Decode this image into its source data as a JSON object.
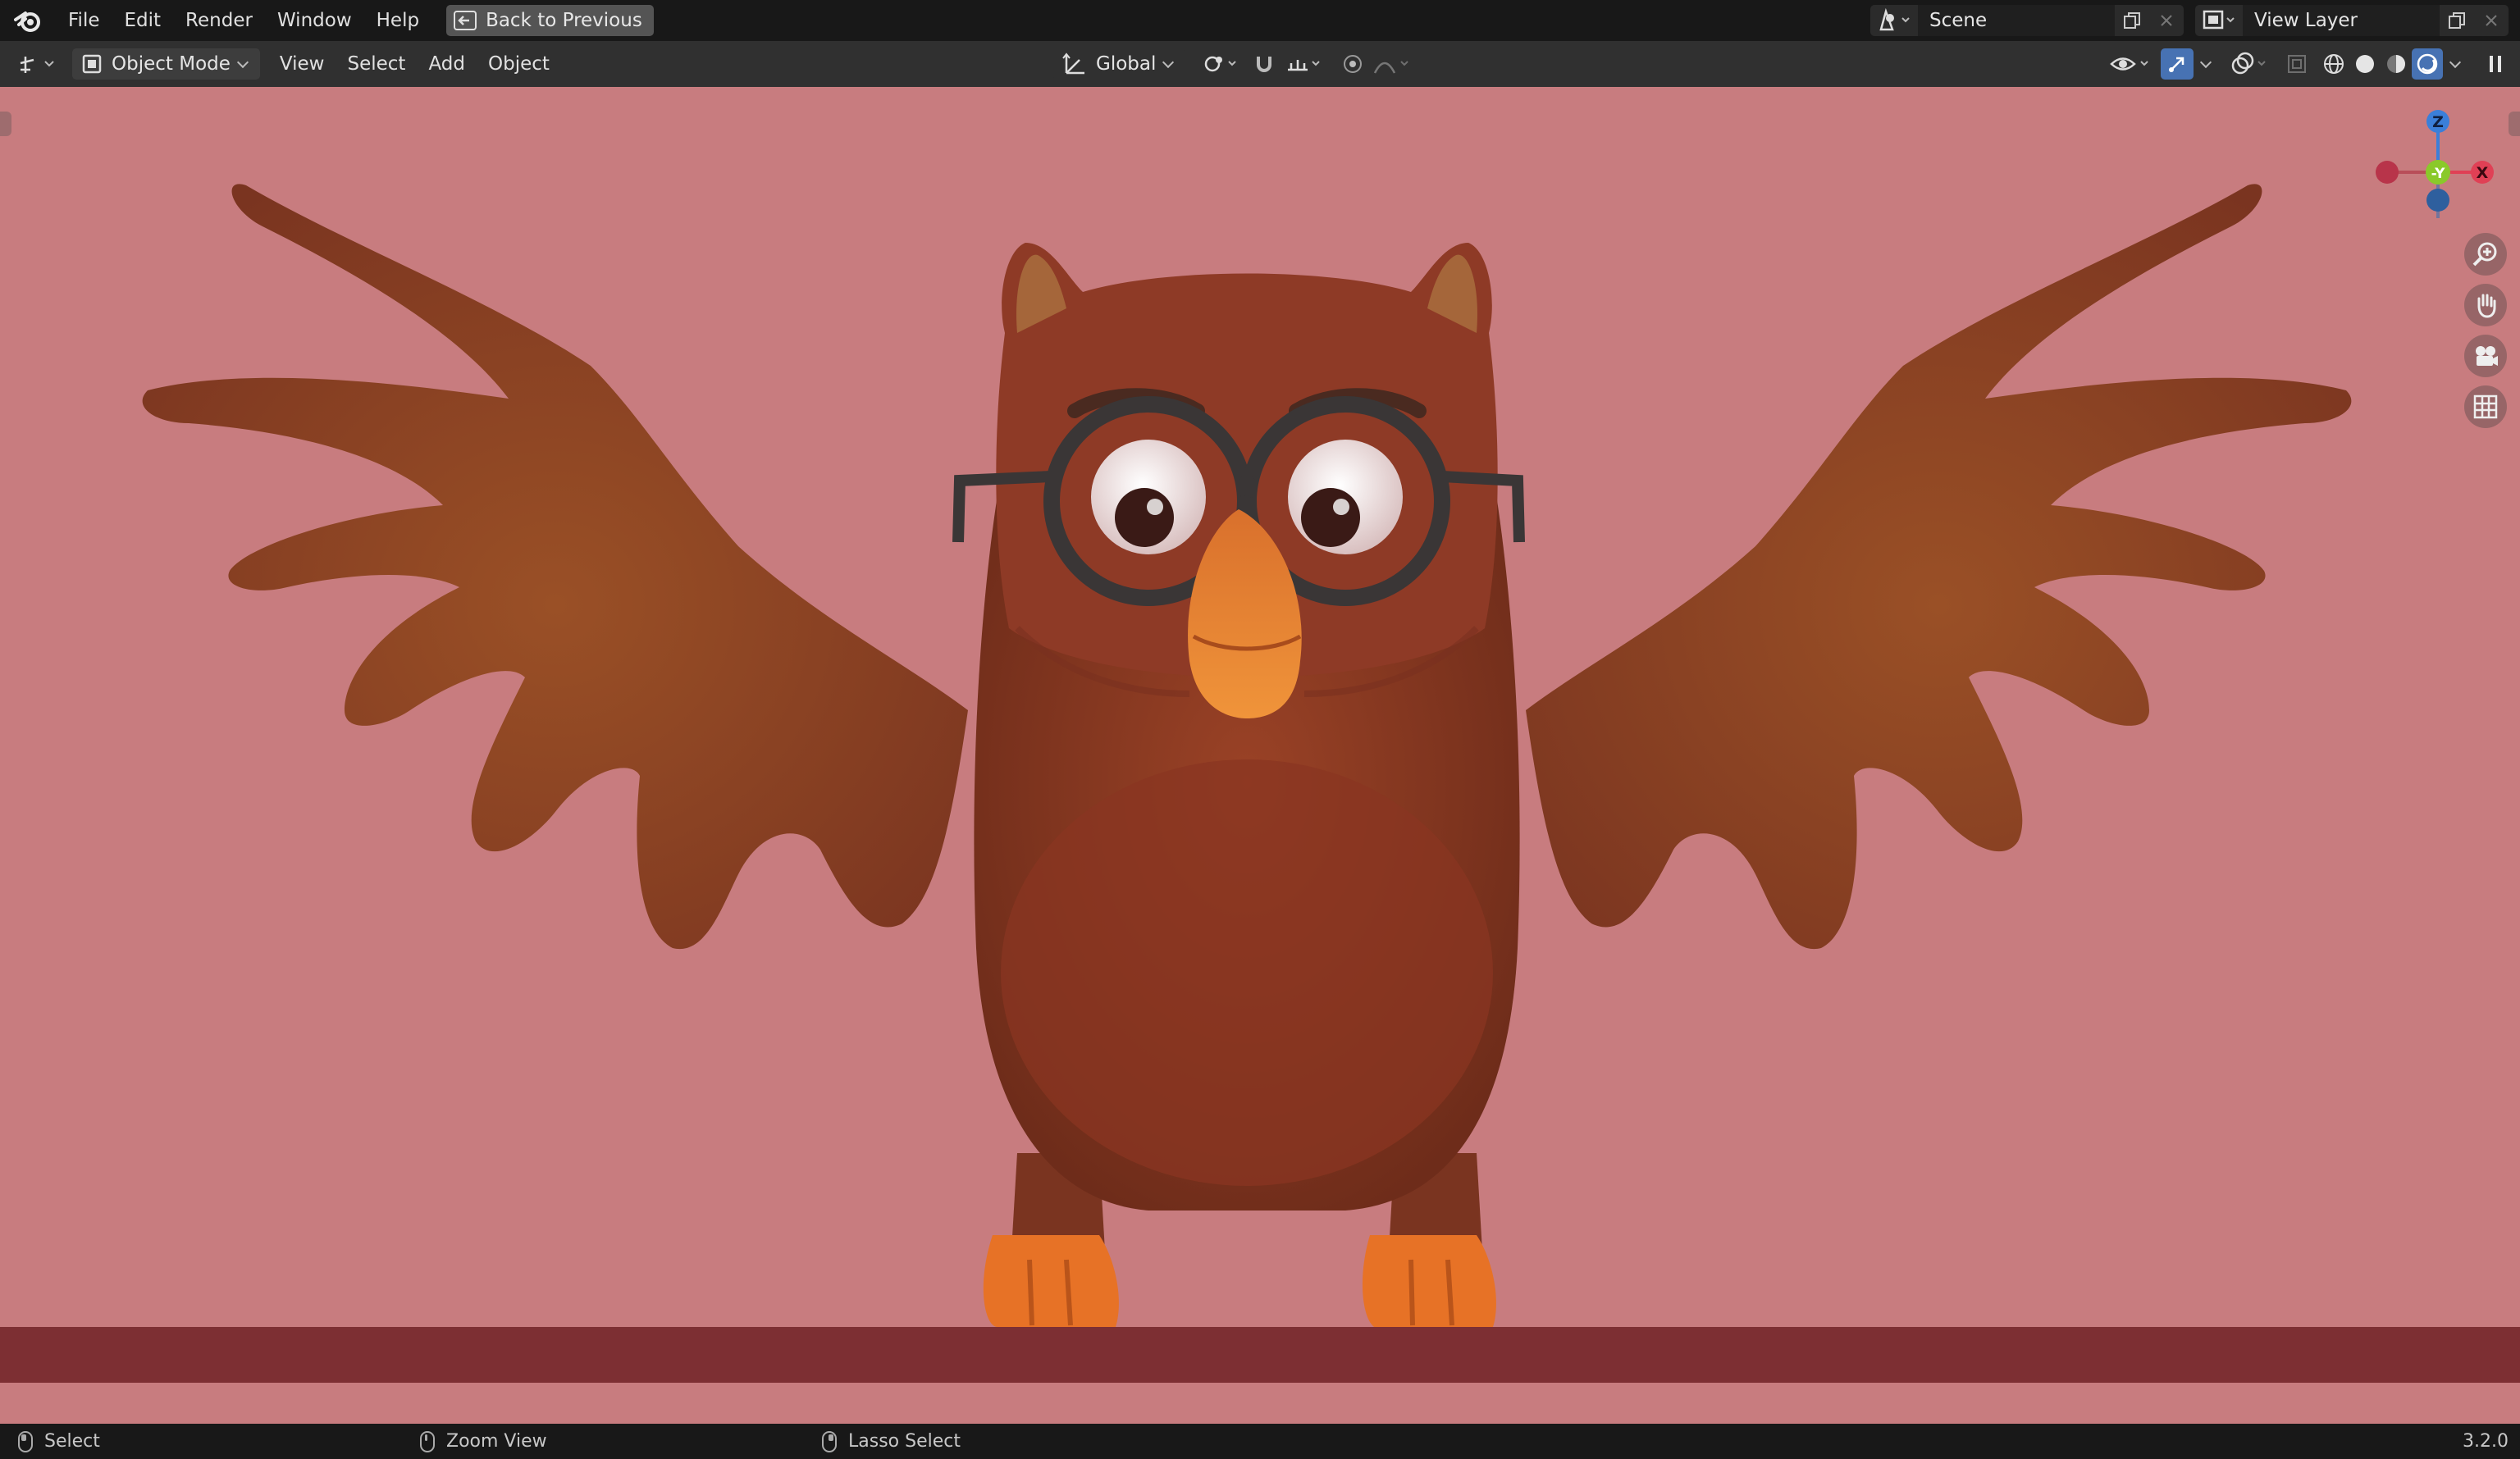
{
  "topbar": {
    "menu": [
      "File",
      "Edit",
      "Render",
      "Window",
      "Help"
    ],
    "back_button": "Back to Previous",
    "scene_label": "Scene",
    "view_layer_label": "View Layer"
  },
  "header": {
    "mode": "Object Mode",
    "menus": [
      "View",
      "Select",
      "Add",
      "Object"
    ],
    "transform_orientation": "Global"
  },
  "viewport": {
    "gizmo": {
      "z": "Z",
      "y": "-Y",
      "x": "X"
    },
    "colors": {
      "background": "#c87c7f",
      "floor": "#7d2f33",
      "owl_body": "#8e3a26",
      "owl_wing": "#8a4424",
      "beak": "#e07a2e",
      "feet": "#e77226"
    }
  },
  "statusbar": {
    "select": "Select",
    "zoom": "Zoom View",
    "lasso": "Lasso Select",
    "version": "3.2.0"
  },
  "icons": [
    "blender-logo-icon",
    "back-arrow-icon",
    "editor-type-icon",
    "object-mode-icon",
    "transform-axes-icon",
    "pivot-icon",
    "snap-magnet-icon",
    "snap-target-icon",
    "proportional-edit-icon",
    "falloff-icon",
    "visibility-icon",
    "gizmo-toggle-icon",
    "overlay-icon",
    "xray-icon",
    "wireframe-shading-icon",
    "solid-shading-icon",
    "material-shading-icon",
    "rendered-shading-icon",
    "pause-icon",
    "zoom-icon",
    "pan-hand-icon",
    "camera-icon",
    "grid-icon",
    "scene-icon",
    "view-layer-icon",
    "copy-icon",
    "close-icon"
  ]
}
